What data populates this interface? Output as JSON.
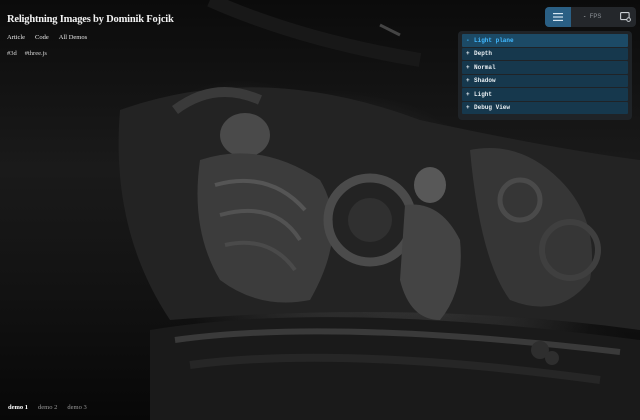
{
  "header": {
    "title": "Relightning Images by Dominik Fojcik",
    "nav": [
      "Article",
      "Code",
      "All Demos"
    ],
    "tags": [
      "#3d",
      "#three.js"
    ]
  },
  "demos": {
    "items": [
      "demo 1",
      "demo 2",
      "demo 3"
    ],
    "active_index": 0
  },
  "toolbar": {
    "menu_icon": "menu-icon",
    "fps_value": "-",
    "fps_unit": "FPS",
    "screenshot_icon": "screenshot-icon",
    "accent": "#2a5f84"
  },
  "panel": {
    "items": [
      {
        "sign": "-",
        "label": "Light plane",
        "expanded": true
      },
      {
        "sign": "+",
        "label": "Depth",
        "expanded": false
      },
      {
        "sign": "+",
        "label": "Normal",
        "expanded": false
      },
      {
        "sign": "+",
        "label": "Shadow",
        "expanded": false
      },
      {
        "sign": "+",
        "label": "Light",
        "expanded": false
      },
      {
        "sign": "+",
        "label": "Debug View",
        "expanded": false
      }
    ],
    "item_color": "#16384d",
    "active_text_color": "#41b8ff"
  }
}
